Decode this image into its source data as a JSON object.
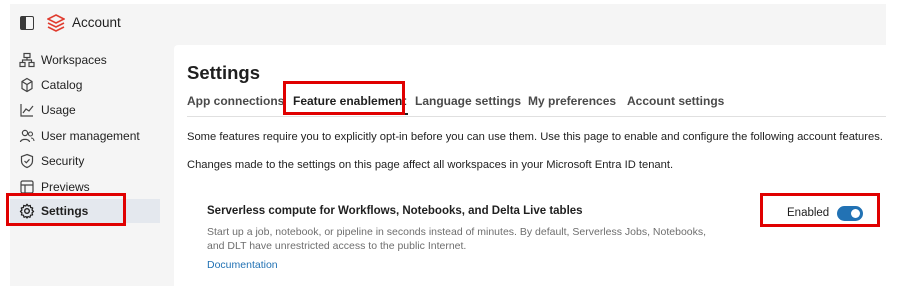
{
  "header": {
    "app_title": "Account",
    "brand_color": "#e03c2f"
  },
  "sidebar": {
    "items": [
      {
        "label": "Workspaces",
        "icon": "workspaces-icon"
      },
      {
        "label": "Catalog",
        "icon": "catalog-icon"
      },
      {
        "label": "Usage",
        "icon": "usage-chart-icon"
      },
      {
        "label": "User management",
        "icon": "users-icon"
      },
      {
        "label": "Security",
        "icon": "shield-icon"
      },
      {
        "label": "Previews",
        "icon": "previews-icon"
      },
      {
        "label": "Settings",
        "icon": "gear-icon",
        "active": true
      }
    ]
  },
  "main": {
    "title": "Settings",
    "tabs": [
      {
        "label": "App connections"
      },
      {
        "label": "Feature enablement",
        "active": true
      },
      {
        "label": "Language settings"
      },
      {
        "label": "My preferences"
      },
      {
        "label": "Account settings"
      }
    ],
    "intro_1": "Some features require you to explicitly opt-in before you can use them. Use this page to enable and configure the following account features.",
    "intro_2": "Changes made to the settings on this page affect all workspaces in your Microsoft Entra ID tenant.",
    "feature": {
      "title": "Serverless compute for Workflows, Notebooks, and Delta Live tables",
      "description_line_1": "Start up a job, notebook, or pipeline in seconds instead of minutes. By default, Serverless Jobs, Notebooks,",
      "description_line_2": "and DLT have unrestricted access to the public Internet.",
      "link": "Documentation",
      "toggle_label": "Enabled",
      "toggle_on": true
    }
  },
  "colors": {
    "accent": "#2272b4",
    "highlight": "#e00000",
    "active_nav_bg": "#e4e8ee"
  }
}
